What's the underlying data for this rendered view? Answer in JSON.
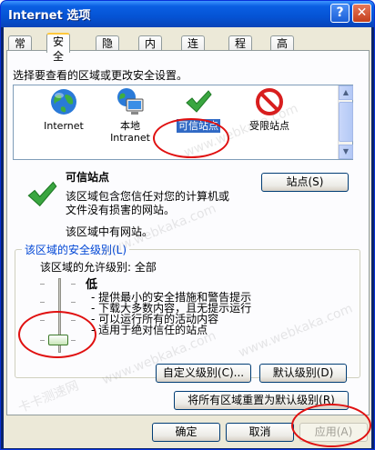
{
  "window": {
    "title": "Internet 选项",
    "help": "?",
    "close": "✕"
  },
  "tabs": [
    {
      "label": "常规"
    },
    {
      "label": "安全"
    },
    {
      "label": "隐私"
    },
    {
      "label": "内容"
    },
    {
      "label": "连接"
    },
    {
      "label": "程序"
    },
    {
      "label": "高级"
    }
  ],
  "security": {
    "instruction": "选择要查看的区域或更改安全设置。",
    "zones": [
      {
        "label": "Internet",
        "icon": "globe-icon"
      },
      {
        "label": "本地\nIntranet",
        "icon": "intranet-icon"
      },
      {
        "label": "可信站点",
        "icon": "checkmark-icon"
      },
      {
        "label": "受限站点",
        "icon": "restricted-icon"
      }
    ],
    "selected_zone": "可信站点",
    "zone_title": "可信站点",
    "zone_desc_1": "该区域包含您信任对您的计算机或",
    "zone_desc_2": "文件没有损害的网站。",
    "zone_sites_note": "该区域中有网站。",
    "sites_button": "站点(S)",
    "level_group_label": "该区域的安全级别(L)",
    "allowed_levels": "该区域的允许级别: 全部",
    "level_name": "低",
    "level_points": [
      "- 提供最小的安全措施和警告提示",
      "- 下载大多数内容，且无提示运行",
      "- 可以运行所有的活动内容",
      "- 适用于绝对信任的站点"
    ],
    "slider_level": "低",
    "custom_level_button": "自定义级别(C)...",
    "default_level_button": "默认级别(D)",
    "reset_all_button": "将所有区域重置为默认级别(R)"
  },
  "footer": {
    "ok": "确定",
    "cancel": "取消",
    "apply": "应用(A)"
  },
  "watermarks": [
    "www.webkaka.com",
    "卡卡测速网"
  ],
  "colors": {
    "titlebar": "#0553d4",
    "selection": "#316ac5",
    "annotation": "#e01010"
  }
}
